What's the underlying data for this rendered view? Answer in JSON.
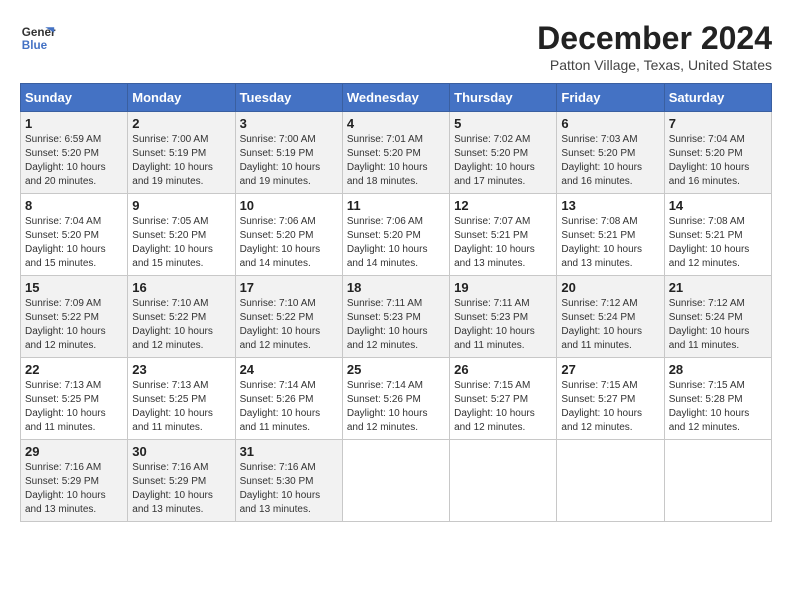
{
  "header": {
    "logo_line1": "General",
    "logo_line2": "Blue",
    "month": "December 2024",
    "location": "Patton Village, Texas, United States"
  },
  "days_of_week": [
    "Sunday",
    "Monday",
    "Tuesday",
    "Wednesday",
    "Thursday",
    "Friday",
    "Saturday"
  ],
  "weeks": [
    [
      {
        "day": "1",
        "sunrise": "Sunrise: 6:59 AM",
        "sunset": "Sunset: 5:20 PM",
        "daylight": "Daylight: 10 hours and 20 minutes."
      },
      {
        "day": "2",
        "sunrise": "Sunrise: 7:00 AM",
        "sunset": "Sunset: 5:19 PM",
        "daylight": "Daylight: 10 hours and 19 minutes."
      },
      {
        "day": "3",
        "sunrise": "Sunrise: 7:00 AM",
        "sunset": "Sunset: 5:19 PM",
        "daylight": "Daylight: 10 hours and 19 minutes."
      },
      {
        "day": "4",
        "sunrise": "Sunrise: 7:01 AM",
        "sunset": "Sunset: 5:20 PM",
        "daylight": "Daylight: 10 hours and 18 minutes."
      },
      {
        "day": "5",
        "sunrise": "Sunrise: 7:02 AM",
        "sunset": "Sunset: 5:20 PM",
        "daylight": "Daylight: 10 hours and 17 minutes."
      },
      {
        "day": "6",
        "sunrise": "Sunrise: 7:03 AM",
        "sunset": "Sunset: 5:20 PM",
        "daylight": "Daylight: 10 hours and 16 minutes."
      },
      {
        "day": "7",
        "sunrise": "Sunrise: 7:04 AM",
        "sunset": "Sunset: 5:20 PM",
        "daylight": "Daylight: 10 hours and 16 minutes."
      }
    ],
    [
      {
        "day": "8",
        "sunrise": "Sunrise: 7:04 AM",
        "sunset": "Sunset: 5:20 PM",
        "daylight": "Daylight: 10 hours and 15 minutes."
      },
      {
        "day": "9",
        "sunrise": "Sunrise: 7:05 AM",
        "sunset": "Sunset: 5:20 PM",
        "daylight": "Daylight: 10 hours and 15 minutes."
      },
      {
        "day": "10",
        "sunrise": "Sunrise: 7:06 AM",
        "sunset": "Sunset: 5:20 PM",
        "daylight": "Daylight: 10 hours and 14 minutes."
      },
      {
        "day": "11",
        "sunrise": "Sunrise: 7:06 AM",
        "sunset": "Sunset: 5:20 PM",
        "daylight": "Daylight: 10 hours and 14 minutes."
      },
      {
        "day": "12",
        "sunrise": "Sunrise: 7:07 AM",
        "sunset": "Sunset: 5:21 PM",
        "daylight": "Daylight: 10 hours and 13 minutes."
      },
      {
        "day": "13",
        "sunrise": "Sunrise: 7:08 AM",
        "sunset": "Sunset: 5:21 PM",
        "daylight": "Daylight: 10 hours and 13 minutes."
      },
      {
        "day": "14",
        "sunrise": "Sunrise: 7:08 AM",
        "sunset": "Sunset: 5:21 PM",
        "daylight": "Daylight: 10 hours and 12 minutes."
      }
    ],
    [
      {
        "day": "15",
        "sunrise": "Sunrise: 7:09 AM",
        "sunset": "Sunset: 5:22 PM",
        "daylight": "Daylight: 10 hours and 12 minutes."
      },
      {
        "day": "16",
        "sunrise": "Sunrise: 7:10 AM",
        "sunset": "Sunset: 5:22 PM",
        "daylight": "Daylight: 10 hours and 12 minutes."
      },
      {
        "day": "17",
        "sunrise": "Sunrise: 7:10 AM",
        "sunset": "Sunset: 5:22 PM",
        "daylight": "Daylight: 10 hours and 12 minutes."
      },
      {
        "day": "18",
        "sunrise": "Sunrise: 7:11 AM",
        "sunset": "Sunset: 5:23 PM",
        "daylight": "Daylight: 10 hours and 12 minutes."
      },
      {
        "day": "19",
        "sunrise": "Sunrise: 7:11 AM",
        "sunset": "Sunset: 5:23 PM",
        "daylight": "Daylight: 10 hours and 11 minutes."
      },
      {
        "day": "20",
        "sunrise": "Sunrise: 7:12 AM",
        "sunset": "Sunset: 5:24 PM",
        "daylight": "Daylight: 10 hours and 11 minutes."
      },
      {
        "day": "21",
        "sunrise": "Sunrise: 7:12 AM",
        "sunset": "Sunset: 5:24 PM",
        "daylight": "Daylight: 10 hours and 11 minutes."
      }
    ],
    [
      {
        "day": "22",
        "sunrise": "Sunrise: 7:13 AM",
        "sunset": "Sunset: 5:25 PM",
        "daylight": "Daylight: 10 hours and 11 minutes."
      },
      {
        "day": "23",
        "sunrise": "Sunrise: 7:13 AM",
        "sunset": "Sunset: 5:25 PM",
        "daylight": "Daylight: 10 hours and 11 minutes."
      },
      {
        "day": "24",
        "sunrise": "Sunrise: 7:14 AM",
        "sunset": "Sunset: 5:26 PM",
        "daylight": "Daylight: 10 hours and 11 minutes."
      },
      {
        "day": "25",
        "sunrise": "Sunrise: 7:14 AM",
        "sunset": "Sunset: 5:26 PM",
        "daylight": "Daylight: 10 hours and 12 minutes."
      },
      {
        "day": "26",
        "sunrise": "Sunrise: 7:15 AM",
        "sunset": "Sunset: 5:27 PM",
        "daylight": "Daylight: 10 hours and 12 minutes."
      },
      {
        "day": "27",
        "sunrise": "Sunrise: 7:15 AM",
        "sunset": "Sunset: 5:27 PM",
        "daylight": "Daylight: 10 hours and 12 minutes."
      },
      {
        "day": "28",
        "sunrise": "Sunrise: 7:15 AM",
        "sunset": "Sunset: 5:28 PM",
        "daylight": "Daylight: 10 hours and 12 minutes."
      }
    ],
    [
      {
        "day": "29",
        "sunrise": "Sunrise: 7:16 AM",
        "sunset": "Sunset: 5:29 PM",
        "daylight": "Daylight: 10 hours and 13 minutes."
      },
      {
        "day": "30",
        "sunrise": "Sunrise: 7:16 AM",
        "sunset": "Sunset: 5:29 PM",
        "daylight": "Daylight: 10 hours and 13 minutes."
      },
      {
        "day": "31",
        "sunrise": "Sunrise: 7:16 AM",
        "sunset": "Sunset: 5:30 PM",
        "daylight": "Daylight: 10 hours and 13 minutes."
      },
      null,
      null,
      null,
      null
    ]
  ]
}
